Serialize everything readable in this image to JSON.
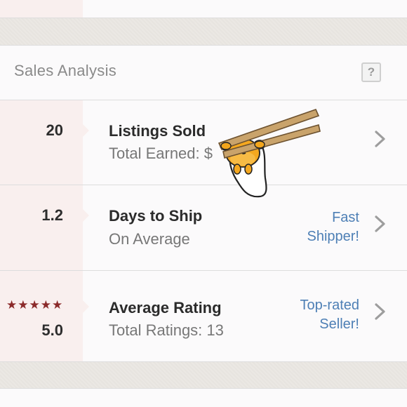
{
  "section": {
    "title": "Sales Analysis",
    "help_label": "?"
  },
  "rows": [
    {
      "value": "20",
      "title": "Listings Sold",
      "subtitle": "Total Earned: $",
      "badge": ""
    },
    {
      "value": "1.2",
      "title": "Days to Ship",
      "subtitle": "On Average",
      "badge_line1": "Fast",
      "badge_line2": "Shipper!"
    },
    {
      "stars": "★★★★★",
      "value": "5.0",
      "title": "Average Rating",
      "subtitle": "Total Ratings: 13",
      "badge_line1": "Top-rated",
      "badge_line2": "Seller!"
    }
  ],
  "colors": {
    "accent_blue": "#4d7fb5",
    "star_red": "#8b2a2a",
    "pink_column": "#f9efee"
  },
  "icons": [
    "question-icon",
    "chevron-right-icon",
    "star-icon",
    "gudetama-sticker"
  ]
}
